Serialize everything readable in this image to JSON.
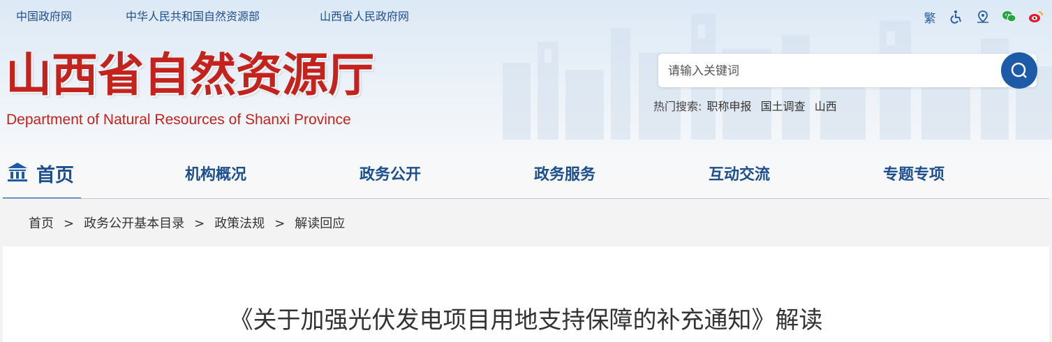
{
  "top_links": [
    "中国政府网",
    "中华人民共和国自然资源部",
    "山西省人民政府网"
  ],
  "top_icons": {
    "traditional": "繁",
    "items": [
      "accessibility-icon",
      "map-pin-icon",
      "wechat-icon",
      "weibo-icon"
    ]
  },
  "logo": {
    "cn": "山西省自然资源厅",
    "en": "Department of Natural Resources of Shanxi Province"
  },
  "search": {
    "placeholder": "请输入关键词",
    "hot_label": "热门搜索:",
    "hot_terms": [
      "职称申报",
      "国土调查",
      "山西"
    ]
  },
  "nav": {
    "home": "首页",
    "items": [
      "机构概况",
      "政务公开",
      "政务服务",
      "互动交流",
      "专题专项"
    ]
  },
  "breadcrumb": [
    "首页",
    "政务公开基本目录",
    "政策法规",
    "解读回应"
  ],
  "breadcrumb_sep": ">",
  "article": {
    "title": "《关于加强光伏发电项目用地支持保障的补充通知》解读"
  },
  "colors": {
    "brand_red": "#c3221d",
    "nav_blue": "#1d4f8f",
    "accent_blue": "#1d5aa7"
  }
}
